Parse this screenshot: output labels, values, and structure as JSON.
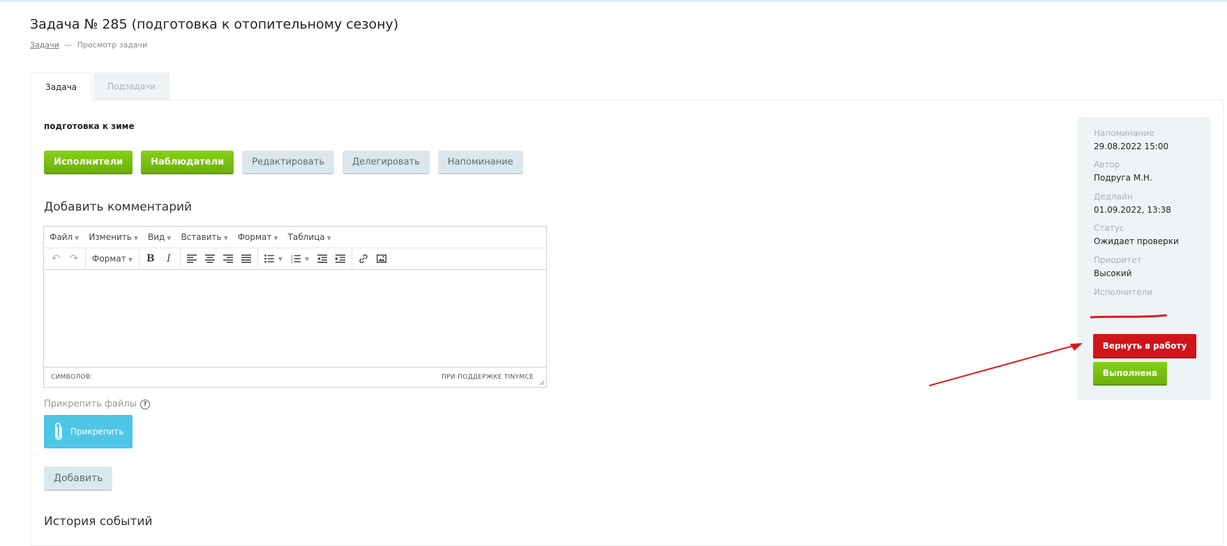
{
  "page": {
    "title": "Задача № 285 (подготовка к отопительному сезону)"
  },
  "breadcrumb": {
    "link": "Задачи",
    "separator": "—",
    "current": "Просмотр задачи"
  },
  "tabs": [
    {
      "label": "Задача",
      "active": true
    },
    {
      "label": "Подзадачи",
      "active": false
    }
  ],
  "task": {
    "description": "подготовка к зиме"
  },
  "actions": {
    "executors": "Исполнители",
    "observers": "Наблюдатели",
    "edit": "Редактировать",
    "delegate": "Делегировать",
    "reminder": "Напоминание"
  },
  "comment": {
    "heading": "Добавить комментарий",
    "menu": [
      "Файл",
      "Изменить",
      "Вид",
      "Вставить",
      "Формат",
      "Таблица"
    ],
    "format_label": "Формат",
    "status_left": "СИМВОЛОВ:",
    "status_right": "ПРИ ПОДДЕРЖКЕ TINYMCE"
  },
  "attach": {
    "label": "Прикрепить файлы",
    "help": "?",
    "button": "Прикрепить"
  },
  "add_button": "Добавить",
  "bottom_heading": "История событий",
  "info": {
    "reminder_label": "Напоминание",
    "reminder_value": "29.08.2022 15:00",
    "author_label": "Автор",
    "author_value": "Подруга М.Н.",
    "deadline_label": "Дедлайн",
    "deadline_value": "01.09.2022, 13:38",
    "status_label": "Статус",
    "status_value": "Ожидает проверки",
    "priority_label": "Приоритет",
    "priority_value": "Высокий",
    "executors_label": "Исполнители"
  },
  "buttons": {
    "return": "Вернуть в работу",
    "done": "Выполнена"
  },
  "colors": {
    "green": "#76bd10",
    "red": "#d0141a",
    "attach_blue": "#4fc6e6",
    "annotation_red": "#e0161c"
  }
}
